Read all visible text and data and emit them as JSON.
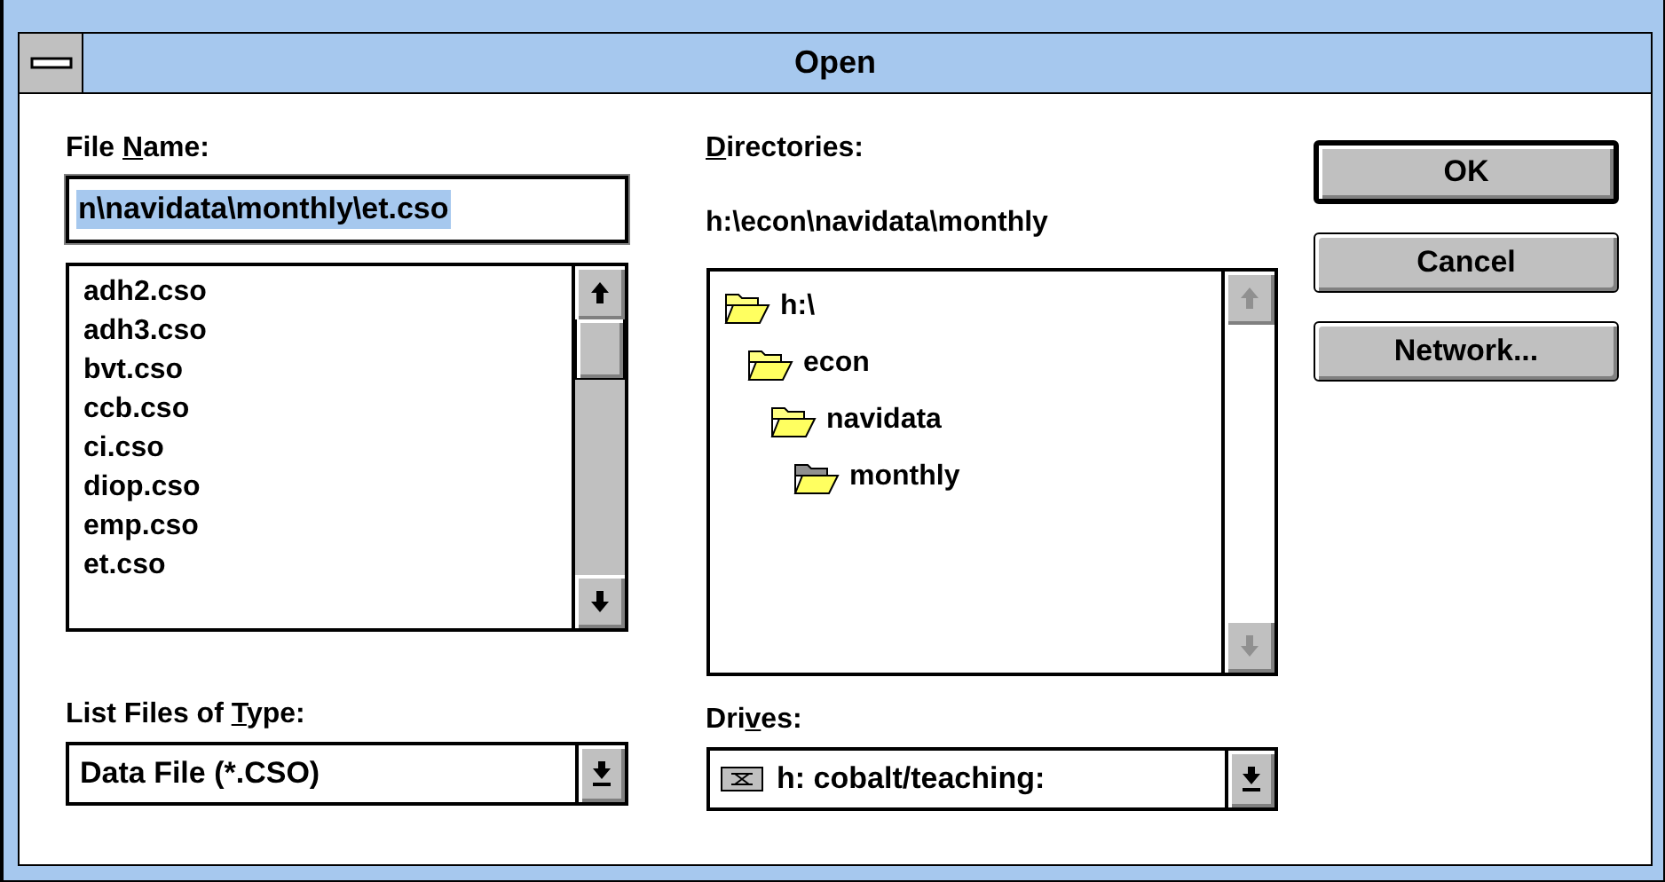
{
  "window": {
    "title": "Open"
  },
  "file_name": {
    "label": {
      "before": "File ",
      "key": "N",
      "after": "ame:"
    },
    "value": "n\\navidata\\monthly\\et.cso",
    "text_selected": true
  },
  "files": {
    "scrollbar_disabled": false,
    "items": [
      {
        "name": "adh2.cso",
        "selected": false
      },
      {
        "name": "adh3.cso",
        "selected": false
      },
      {
        "name": "bvt.cso",
        "selected": false
      },
      {
        "name": "ccb.cso",
        "selected": false
      },
      {
        "name": "ci.cso",
        "selected": false
      },
      {
        "name": "diop.cso",
        "selected": false
      },
      {
        "name": "emp.cso",
        "selected": false
      },
      {
        "name": "et.cso",
        "selected": false
      }
    ]
  },
  "directories": {
    "label": {
      "key": "D",
      "after": "irectories:"
    },
    "path": "h:\\econ\\navidata\\monthly",
    "scrollbar_disabled": true,
    "tree": [
      {
        "name": "h:\\",
        "current": false,
        "children": [
          {
            "name": "econ",
            "current": false,
            "children": [
              {
                "name": "navidata",
                "current": false,
                "children": [
                  {
                    "name": "monthly",
                    "current": true
                  }
                ]
              }
            ]
          }
        ]
      }
    ]
  },
  "file_type": {
    "label": {
      "before": "List Files of ",
      "key": "T",
      "after": "ype:"
    },
    "value": "Data File (*.CSO)"
  },
  "drives": {
    "label": {
      "before": "Dri",
      "key": "v",
      "after": "es:"
    },
    "value": "h: cobalt/teaching:"
  },
  "buttons": [
    {
      "label": "OK",
      "default": true
    },
    {
      "label": "Cancel",
      "default": false
    },
    {
      "label": "Network...",
      "default": false
    }
  ]
}
